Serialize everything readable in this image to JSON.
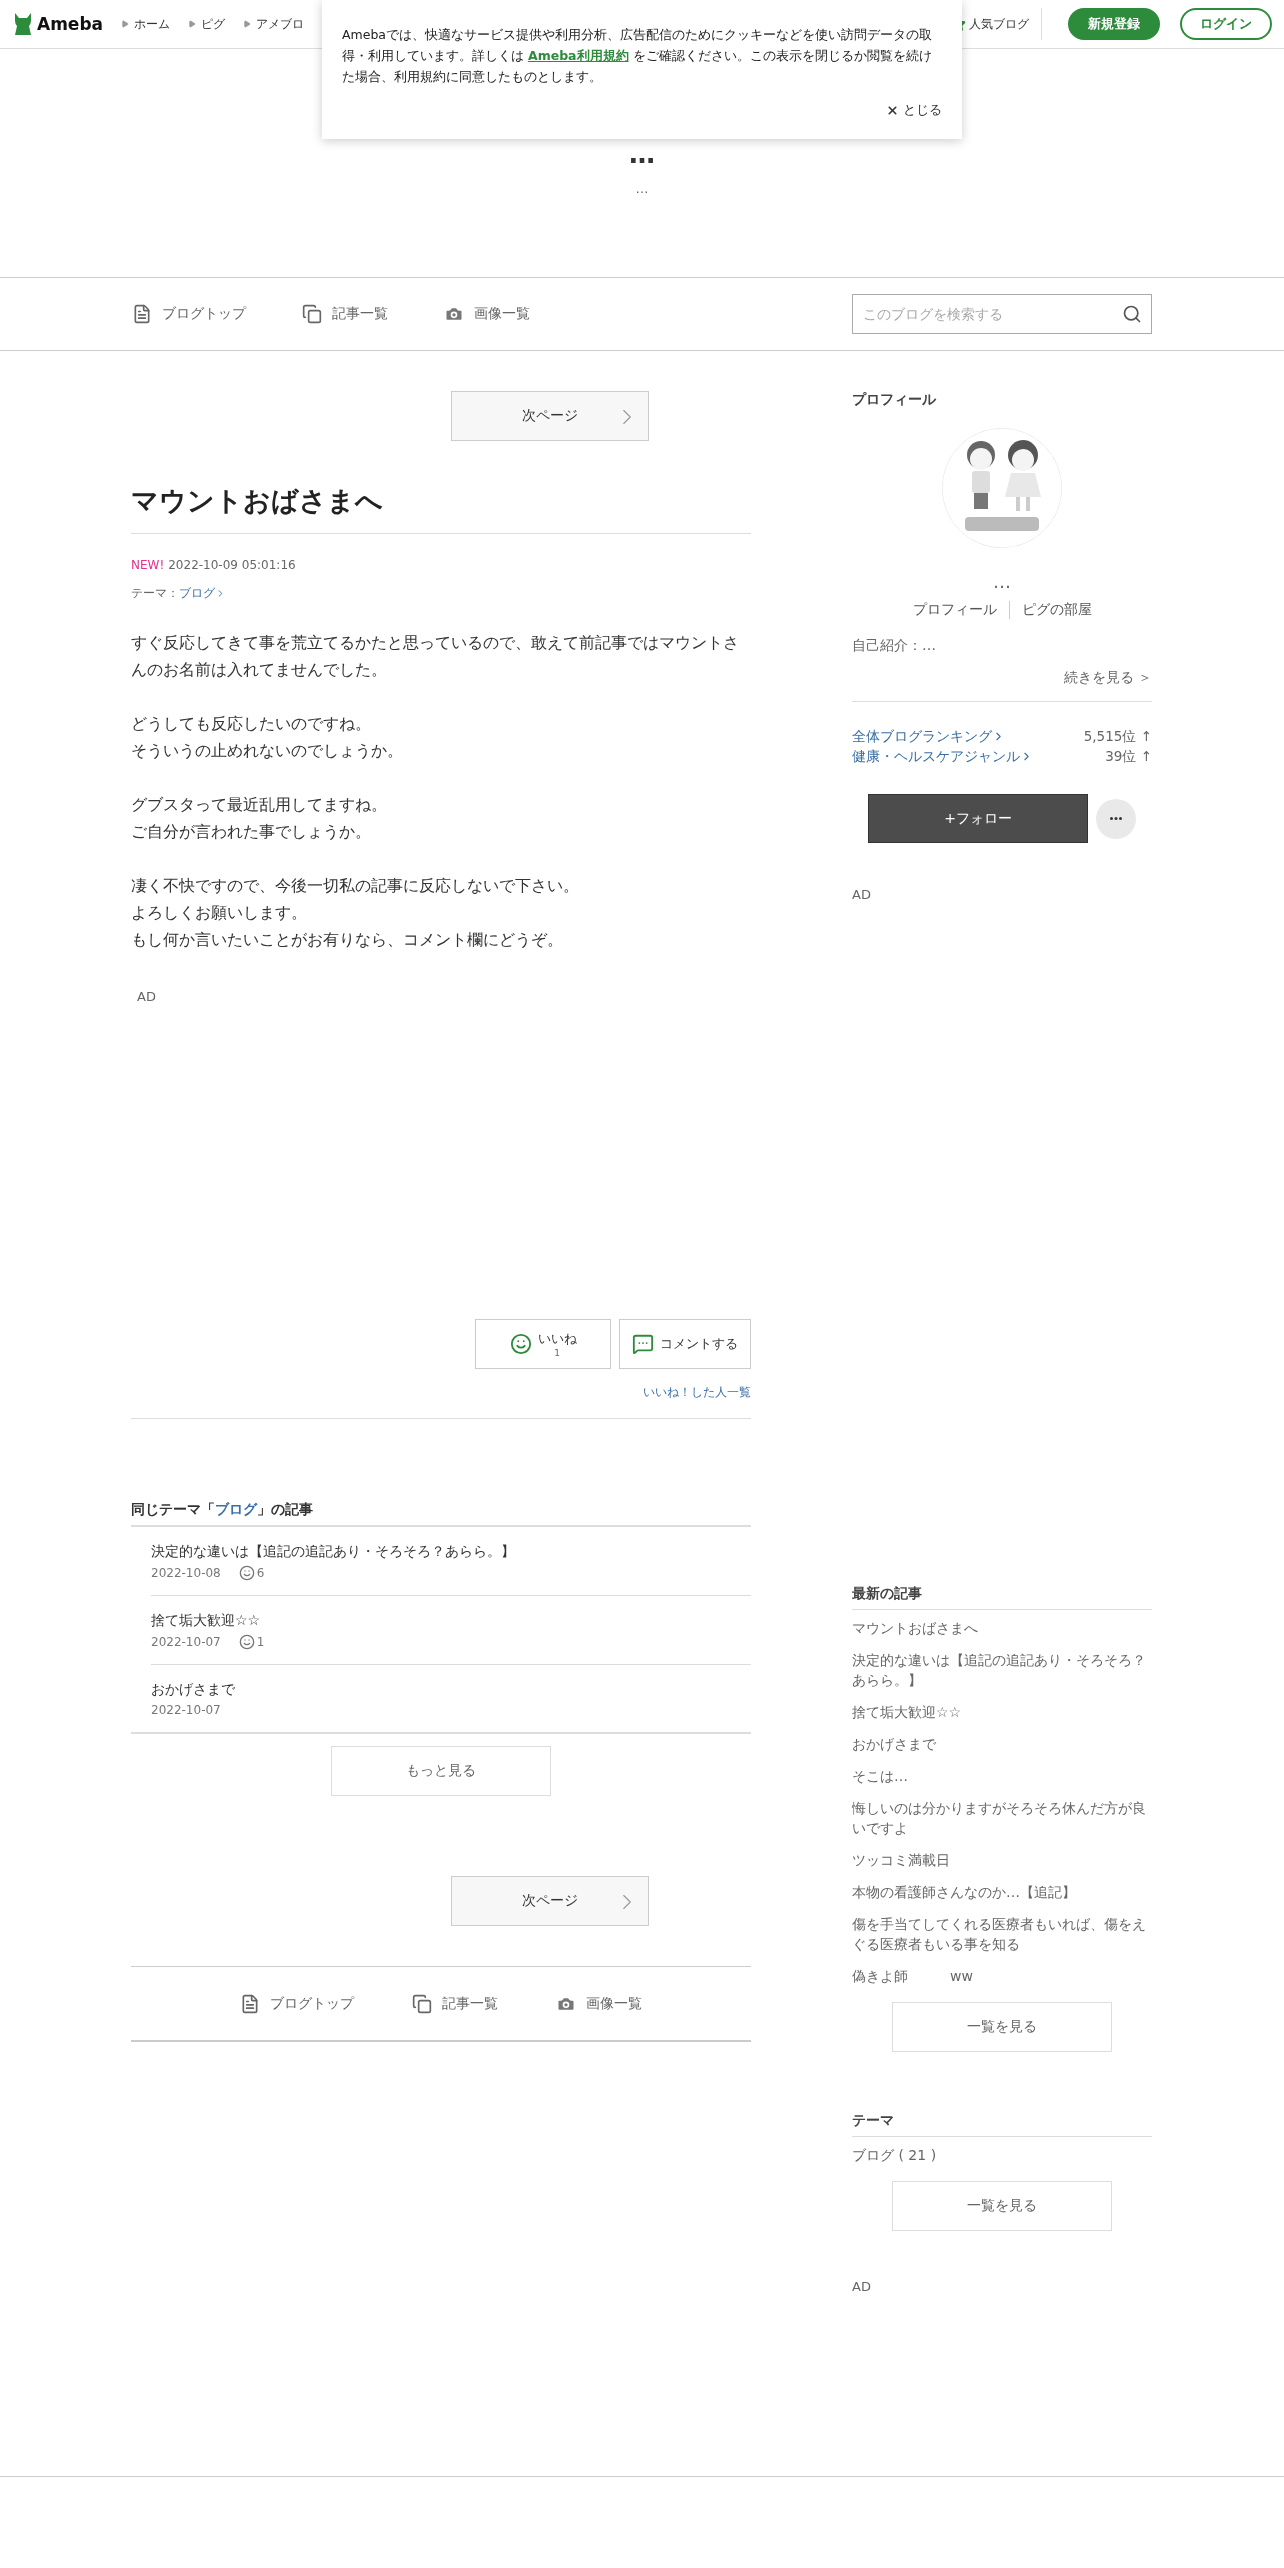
{
  "header": {
    "logo": "Ameba",
    "breadcrumbs": [
      "ホーム",
      "ピグ",
      "アメブロ"
    ],
    "popular": "人気ブログ",
    "signup": "新規登録",
    "login": "ログイン"
  },
  "cookie_notice": {
    "before": "Amebaでは、快適なサービス提供や利用分析、広告配信のためにクッキーなどを使い訪問データの取得・利用しています。詳しくは ",
    "link": "Ameba利用規約",
    "after": " をご確認ください。この表示を閉じるか閲覧を続けた場合、利用規約に同意したものとします。",
    "close": "とじる"
  },
  "blog_header": {
    "title": "…",
    "description": "…"
  },
  "blog_nav": {
    "items": [
      {
        "kind": "top",
        "label": "ブログトップ"
      },
      {
        "kind": "list",
        "label": "記事一覧"
      },
      {
        "kind": "images",
        "label": "画像一覧"
      }
    ],
    "search": {
      "placeholder": "このブログを検索する"
    }
  },
  "article": {
    "next_page": "次ページ",
    "title": "マウントおばさまへ",
    "new_badge": "NEW!",
    "datetime": "2022-10-09 05:01:16",
    "theme_label": "テーマ：",
    "theme": "ブログ",
    "paragraphs": [
      [
        "すぐ反応してきて事を荒立てるかたと思っているので、敢えて前記事ではマウントさんのお名前は入れてませんでした。"
      ],
      [
        "どうしても反応したいのですね。",
        "そういうの止めれないのでしょうか。"
      ],
      [
        "グブスタって最近乱用してますね。",
        "ご自分が言われた事でしょうか。"
      ],
      [
        "凄く不快ですので、今後一切私の記事に反応しないで下さい。",
        "よろしくお願いします。",
        "もし何か言いたいことがお有りなら、コメント欄にどうぞ。"
      ]
    ],
    "ad": "AD",
    "like": {
      "label": "いいね",
      "count": "1"
    },
    "comment": "コメントする",
    "liked_list": "いいね！した人一覧"
  },
  "same_theme": {
    "before": "同じテーマ「",
    "theme": "ブログ",
    "after": "」の記事",
    "items": [
      {
        "title": "決定的な違いは【追記の追記あり・そろそろ？あらら。】",
        "date": "2022-10-08",
        "likes": "6"
      },
      {
        "title": "捨て垢大歓迎☆☆",
        "date": "2022-10-07",
        "likes": "1"
      },
      {
        "title": "おかげさまで",
        "date": "2022-10-07"
      }
    ],
    "more": "もっと見る",
    "next_page": "次ページ"
  },
  "footer_nav": [
    {
      "kind": "top",
      "label": "ブログトップ"
    },
    {
      "kind": "list",
      "label": "記事一覧"
    },
    {
      "kind": "images",
      "label": "画像一覧"
    }
  ],
  "sidebar": {
    "profile": {
      "heading": "プロフィール",
      "name": "…",
      "links": [
        "プロフィール",
        "ピグの部屋"
      ],
      "intro": "自己紹介：…",
      "more": "続きを見る ＞",
      "rankings": [
        {
          "label": "全体ブログランキング",
          "rank": "5,515位 ↑"
        },
        {
          "label": "健康・ヘルスケアジャンル",
          "rank": "39位 ↑"
        }
      ],
      "follow": "+フォロー"
    },
    "ad": "AD",
    "latest": {
      "heading": "最新の記事",
      "items": [
        "マウントおばさまへ",
        "決定的な違いは【追記の追記あり・そろそろ？あらら。】",
        "捨て垢大歓迎☆☆",
        "おかげさまで",
        "そこは…",
        "悔しいのは分かりますがそろそろ休んだ方が良いですよ",
        "ツッコミ満載日",
        "本物の看護師さんなのか…【追記】",
        "傷を手当てしてくれる医療者もいれば、傷をえぐる医療者もいる事を知る",
        "偽きよ師　　　ww"
      ],
      "more": "一覧を見る"
    },
    "themes": {
      "heading": "テーマ",
      "items": [
        "ブログ ( 21 )"
      ],
      "more": "一覧を見る"
    },
    "ad_bottom": "AD"
  }
}
